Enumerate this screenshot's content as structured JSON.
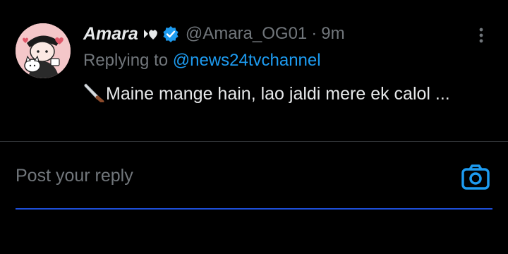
{
  "tweet": {
    "display_name": "Amara",
    "name_emoji": "heart-ribbon-icon",
    "verified_icon": "verified-badge-icon",
    "handle": "@Amara_OG01",
    "separator": "·",
    "time": "9m",
    "replying_prefix": "Replying to",
    "replying_to": "@news24tvchannel",
    "text_emoji": "knife-icon",
    "text": "Maine mange hain, lao jaldi mere ek calol ..."
  },
  "composer": {
    "placeholder": "Post your reply",
    "media_icon": "camera-icon"
  },
  "colors": {
    "background": "#000000",
    "primary_text": "#e7e9ea",
    "secondary_text": "#71767b",
    "accent": "#1d9bf0",
    "divider": "#2f3336",
    "focus_line": "#1d4ed8"
  }
}
